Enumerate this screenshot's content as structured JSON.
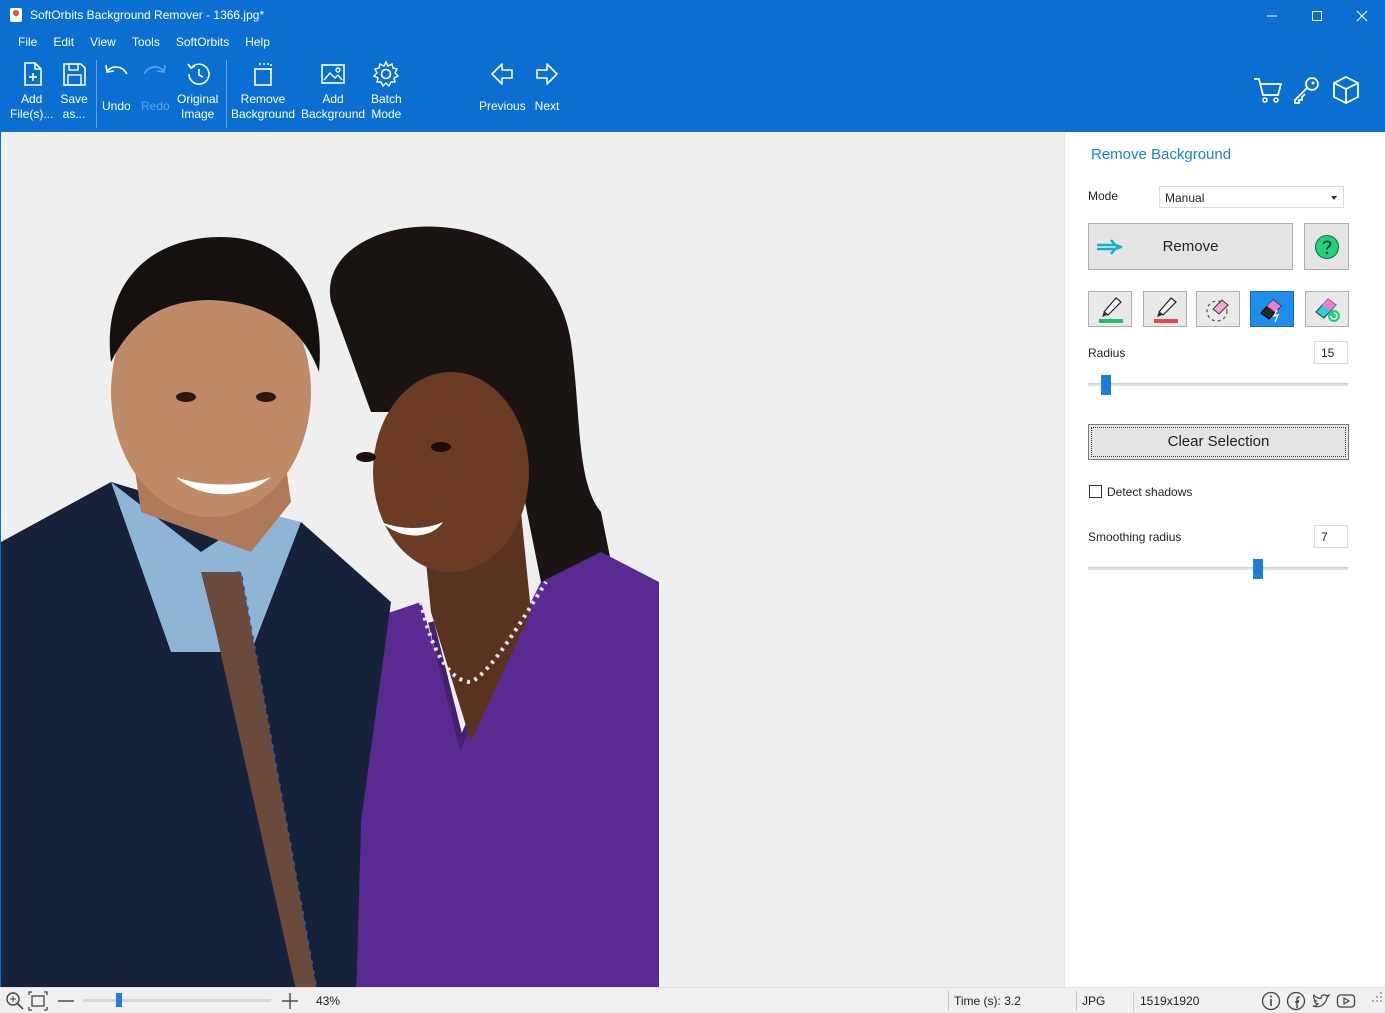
{
  "window": {
    "title": "SoftOrbits Background Remover - 1366.jpg*"
  },
  "menu": [
    "File",
    "Edit",
    "View",
    "Tools",
    "SoftOrbits",
    "Help"
  ],
  "toolbar": {
    "add_files": [
      "Add",
      "File(s)..."
    ],
    "save_as": [
      "Save",
      "as..."
    ],
    "undo": "Undo",
    "redo": "Redo",
    "original_image": [
      "Original",
      "Image"
    ],
    "remove_background": [
      "Remove",
      "Background"
    ],
    "add_background": [
      "Add",
      "Background"
    ],
    "batch_mode": [
      "Batch",
      "Mode"
    ],
    "previous": "Previous",
    "next": "Next"
  },
  "panel": {
    "title": "Remove Background",
    "mode_label": "Mode",
    "mode_value": "Manual",
    "remove_button": "Remove",
    "radius_label": "Radius",
    "radius_value": "15",
    "radius_level": 0.05,
    "clear_selection": "Clear Selection",
    "detect_shadows_label": "Detect shadows",
    "detect_shadows_checked": false,
    "smoothing_label": "Smoothing radius",
    "smoothing_value": "7",
    "smoothing_level": 0.66
  },
  "status": {
    "zoom": "43%",
    "time": "Time (s): 3.2",
    "format": "JPG",
    "dimensions": "1519x1920"
  },
  "colors": {
    "accent": "#0a6fd1",
    "panel_title": "#1a7fd6",
    "active_tool": "#1e8ee8",
    "remove_arrow": "#12b3c9",
    "help_green": "#25d07c"
  }
}
